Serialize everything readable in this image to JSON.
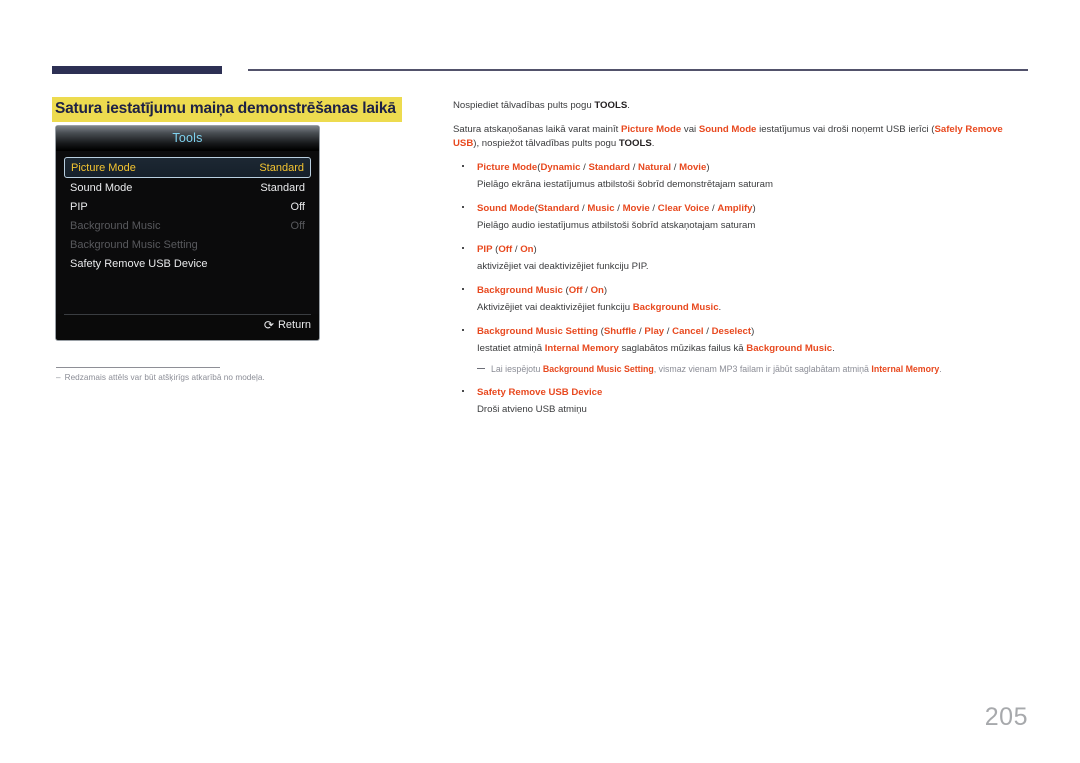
{
  "page": {
    "number": "205",
    "heading": "Satura iestatījumu maiņa demonstrēšanas laikā",
    "heading_highlight_color": "#eddb4f",
    "heading_text_color": "#1d2145",
    "accent_color": "#e8491f",
    "rule_color": "#2d3054"
  },
  "osd": {
    "title": "Tools",
    "title_color": "#7fd2ef",
    "rows": [
      {
        "label": "Picture Mode",
        "value": "Standard",
        "state": "selected"
      },
      {
        "label": "Sound Mode",
        "value": "Standard",
        "state": "normal"
      },
      {
        "label": "PIP",
        "value": "Off",
        "state": "normal"
      },
      {
        "label": "Background Music",
        "value": "Off",
        "state": "disabled"
      },
      {
        "label": "Background Music Setting",
        "value": "",
        "state": "disabled"
      },
      {
        "label": "Safety Remove USB Device",
        "value": "",
        "state": "normal"
      }
    ],
    "footer": {
      "return_label": "Return",
      "return_icon": "return-arrow-icon"
    }
  },
  "figure_note": {
    "dash": "–",
    "text": "Redzamais attēls var būt atšķirīgs atkarībā no modeļa."
  },
  "content": {
    "intro_1": {
      "before": "Nospiediet tālvadības pults pogu ",
      "bold": "TOOLS",
      "after": "."
    },
    "intro_2": {
      "p1": "Satura atskaņošanas laikā varat mainīt ",
      "kw1": "Picture Mode",
      "p2": " vai ",
      "kw2": "Sound Mode",
      "p3": " iestatījumus vai droši noņemt USB ierīci (",
      "kw3": "Safely Remove USB",
      "p4": "), nospiežot tālvadības pults pogu ",
      "bold1": "TOOLS",
      "p5": "."
    },
    "bullets": [
      {
        "name": "Picture Mode",
        "options_open": "(",
        "options": [
          "Dynamic",
          "Standard",
          "Natural",
          "Movie"
        ],
        "options_close": ")",
        "desc": "Pielāgo ekrāna iestatījumus atbilstoši šobrīd demonstrētajam saturam"
      },
      {
        "name": "Sound Mode",
        "options_open": "(",
        "options": [
          "Standard",
          "Music",
          "Movie",
          "Clear Voice",
          "Amplify"
        ],
        "options_close": ")",
        "desc": "Pielāgo audio iestatījumus atbilstoši šobrīd atskaņotajam saturam"
      },
      {
        "name": "PIP",
        "options_open": "(",
        "options": [
          "Off",
          "On"
        ],
        "options_close": ")",
        "desc": "aktivizējiet vai deaktivizējiet funkciju PIP."
      },
      {
        "name": "Background Music",
        "options_open": "(",
        "options": [
          "Off",
          "On"
        ],
        "options_close": ")",
        "desc_pre": "Aktivizējiet vai deaktivizējiet funkciju ",
        "desc_kw": "Background Music",
        "desc_post": "."
      },
      {
        "name": "Background Music Setting",
        "options_open": "(",
        "options": [
          "Shuffle",
          "Play",
          "Cancel",
          "Deselect"
        ],
        "options_close": ")",
        "desc_pre": "Iestatiet atmiņā ",
        "desc_kw1": "Internal Memory",
        "desc_mid": " saglabātos mūzikas failus kā ",
        "desc_kw2": "Background Music",
        "desc_post": "."
      },
      {
        "name": "Safety Remove USB Device",
        "desc": "Droši atvieno USB atmiņu"
      }
    ],
    "subnote": {
      "p1": "Lai iespējotu ",
      "kw1": "Background Music Setting",
      "p2": ", vismaz vienam MP3 failam ir jābūt saglabātam atmiņā ",
      "kw2": "Internal Memory",
      "p3": "."
    }
  }
}
